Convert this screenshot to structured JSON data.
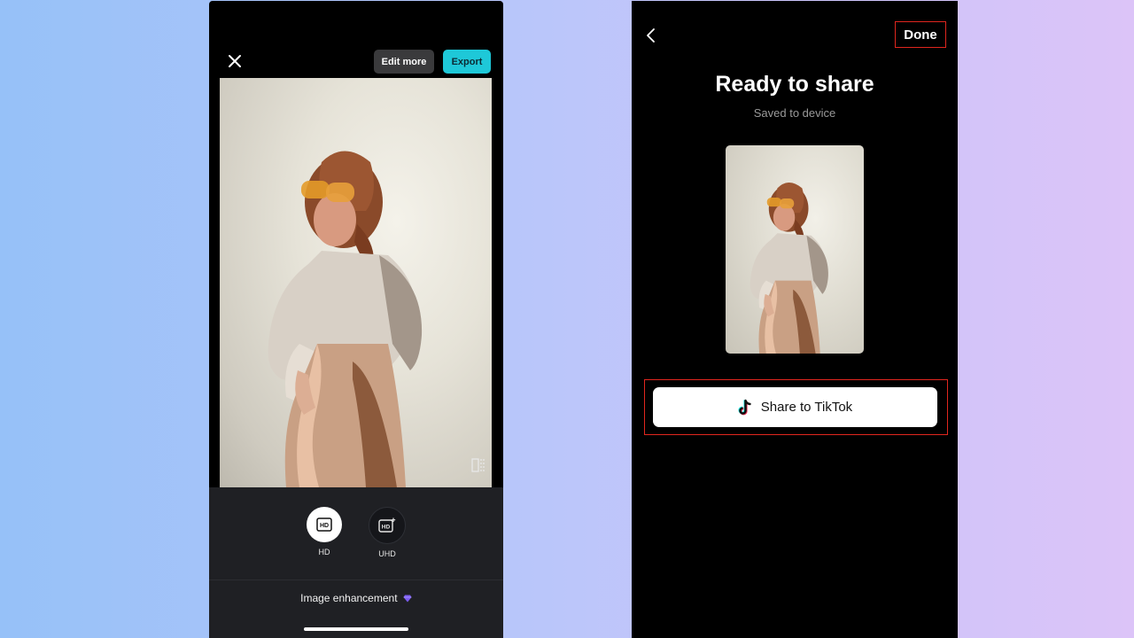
{
  "left_screen": {
    "edit_more_label": "Edit more",
    "export_label": "Export",
    "quality_options": [
      {
        "label": "HD",
        "badge": "HD",
        "selected": true
      },
      {
        "label": "UHD",
        "badge": "HD",
        "selected": false
      }
    ],
    "enhancement_label": "Image enhancement",
    "colors": {
      "export_accent": "#1ec8d8",
      "panel_bg": "#1f2024",
      "gem": "#7b5cf0"
    }
  },
  "right_screen": {
    "done_label": "Done",
    "title": "Ready to share",
    "subtitle": "Saved to device",
    "share_button_label": "Share to TikTok",
    "colors": {
      "highlight_border": "#e0261e",
      "tiktok_cyan": "#25f4ee",
      "tiktok_red": "#fe2c55"
    }
  }
}
